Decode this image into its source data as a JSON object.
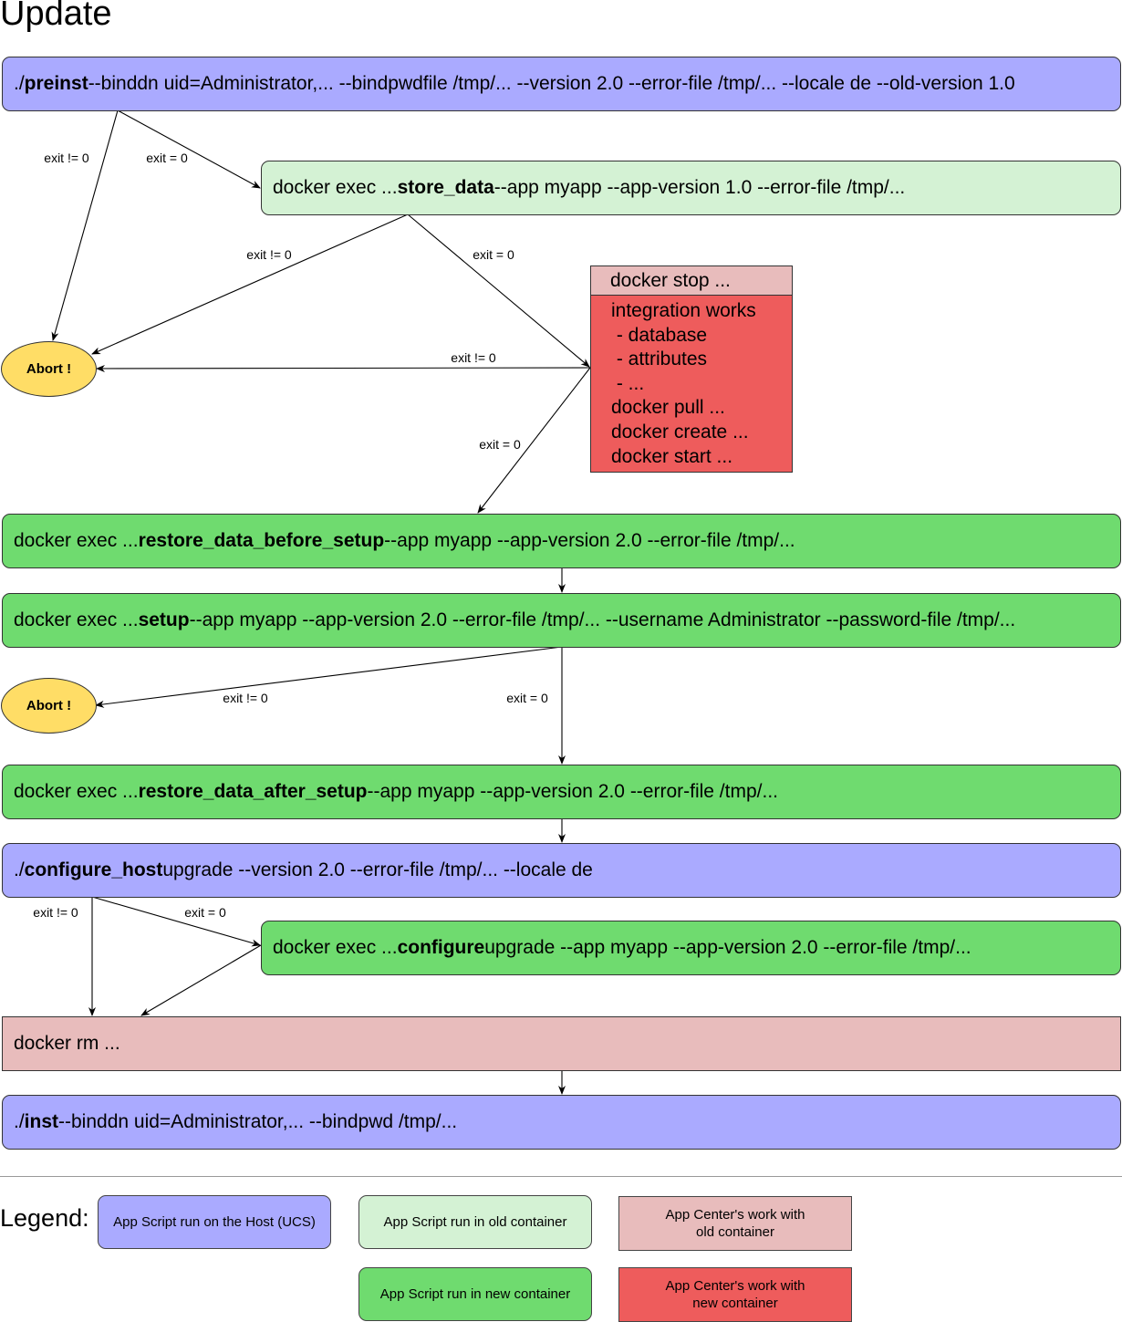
{
  "title": "Update",
  "boxes": {
    "preinst": {
      "pre": "./",
      "bold": "preinst",
      "post": " --binddn uid=Administrator,... --bindpwdfile /tmp/... --version 2.0 --error-file /tmp/... --locale de --old-version 1.0"
    },
    "store_data": {
      "pre": "docker exec ... ",
      "bold": "store_data",
      "post": " --app myapp  --app-version 1.0 --error-file /tmp/..."
    },
    "docker_stop": {
      "header": "docker stop ...",
      "lines": [
        "integration works",
        " - database",
        " - attributes",
        " - ...",
        "docker pull ...",
        "docker create ...",
        "docker start ..."
      ]
    },
    "restore_before": {
      "pre": "docker exec ... ",
      "bold": "restore_data_before_setup",
      "post": " --app myapp --app-version 2.0 --error-file /tmp/..."
    },
    "setup": {
      "pre": "docker exec ... ",
      "bold": "setup",
      "post": " --app myapp --app-version 2.0 --error-file /tmp/... --username Administrator --password-file /tmp/..."
    },
    "restore_after": {
      "pre": "docker exec ... ",
      "bold": "restore_data_after_setup",
      "post": " --app myapp --app-version 2.0 --error-file /tmp/..."
    },
    "configure_host": {
      "pre": "./",
      "bold": "configure_host",
      "post": " upgrade --version 2.0 --error-file /tmp/... --locale de"
    },
    "configure": {
      "pre": "docker exec ... ",
      "bold": "configure",
      "post": " upgrade --app myapp --app-version 2.0 --error-file /tmp/..."
    },
    "docker_rm": {
      "text": "docker rm ..."
    },
    "inst": {
      "pre": "./",
      "bold": "inst",
      "post": " --binddn uid=Administrator,... --bindpwd /tmp/..."
    }
  },
  "abort_label": "Abort !",
  "edge_labels": {
    "fail": "exit != 0",
    "ok": "exit = 0"
  },
  "legend": {
    "label": "Legend:",
    "host": "App Script run on the Host (UCS)",
    "old_container": "App Script run in old container",
    "new_container": "App Script run in new container",
    "ac_old": "App Center's work with old container",
    "ac_new": "App Center's work with new container"
  },
  "colors": {
    "host": "#aaaaff",
    "old_container": "#d4f2d4",
    "new_container": "#6fdb6f",
    "ac_old": "#e8bcbc",
    "ac_new": "#ee5c5c",
    "abort": "#ffdd66"
  }
}
